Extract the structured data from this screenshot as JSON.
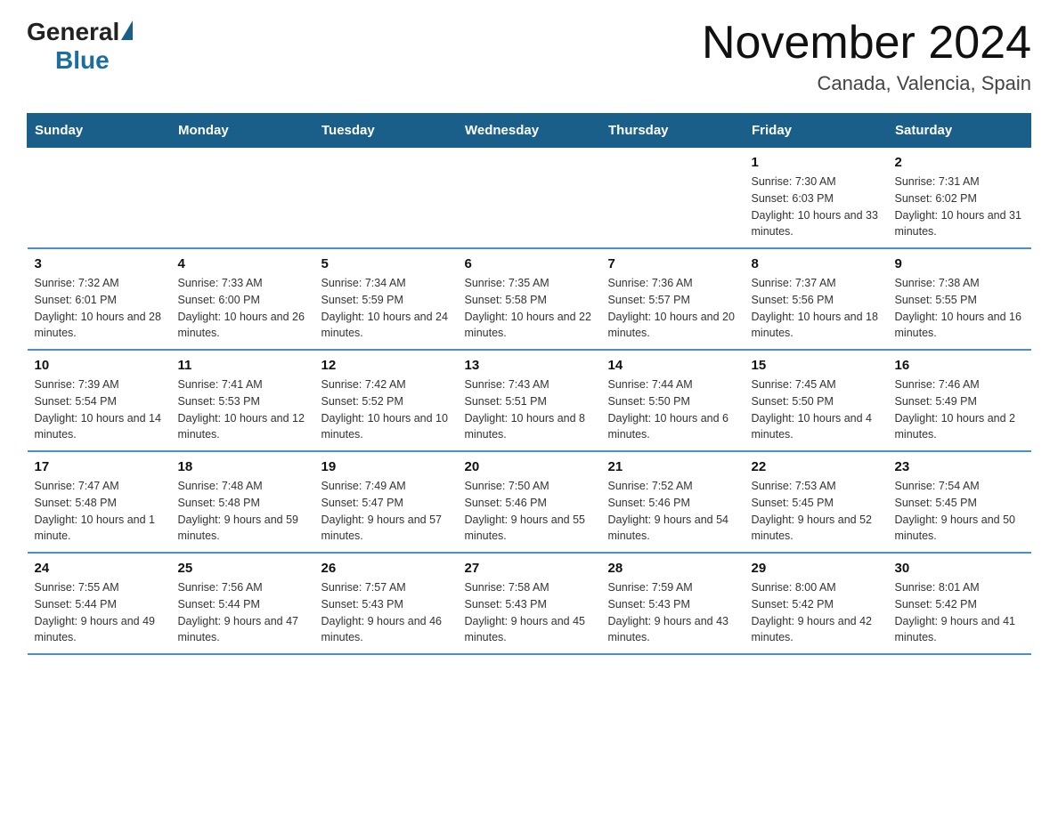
{
  "header": {
    "title": "November 2024",
    "subtitle": "Canada, Valencia, Spain",
    "logo_general": "General",
    "logo_blue": "Blue"
  },
  "days_of_week": [
    "Sunday",
    "Monday",
    "Tuesday",
    "Wednesday",
    "Thursday",
    "Friday",
    "Saturday"
  ],
  "weeks": [
    [
      {
        "day": "",
        "sunrise": "",
        "sunset": "",
        "daylight": ""
      },
      {
        "day": "",
        "sunrise": "",
        "sunset": "",
        "daylight": ""
      },
      {
        "day": "",
        "sunrise": "",
        "sunset": "",
        "daylight": ""
      },
      {
        "day": "",
        "sunrise": "",
        "sunset": "",
        "daylight": ""
      },
      {
        "day": "",
        "sunrise": "",
        "sunset": "",
        "daylight": ""
      },
      {
        "day": "1",
        "sunrise": "Sunrise: 7:30 AM",
        "sunset": "Sunset: 6:03 PM",
        "daylight": "Daylight: 10 hours and 33 minutes."
      },
      {
        "day": "2",
        "sunrise": "Sunrise: 7:31 AM",
        "sunset": "Sunset: 6:02 PM",
        "daylight": "Daylight: 10 hours and 31 minutes."
      }
    ],
    [
      {
        "day": "3",
        "sunrise": "Sunrise: 7:32 AM",
        "sunset": "Sunset: 6:01 PM",
        "daylight": "Daylight: 10 hours and 28 minutes."
      },
      {
        "day": "4",
        "sunrise": "Sunrise: 7:33 AM",
        "sunset": "Sunset: 6:00 PM",
        "daylight": "Daylight: 10 hours and 26 minutes."
      },
      {
        "day": "5",
        "sunrise": "Sunrise: 7:34 AM",
        "sunset": "Sunset: 5:59 PM",
        "daylight": "Daylight: 10 hours and 24 minutes."
      },
      {
        "day": "6",
        "sunrise": "Sunrise: 7:35 AM",
        "sunset": "Sunset: 5:58 PM",
        "daylight": "Daylight: 10 hours and 22 minutes."
      },
      {
        "day": "7",
        "sunrise": "Sunrise: 7:36 AM",
        "sunset": "Sunset: 5:57 PM",
        "daylight": "Daylight: 10 hours and 20 minutes."
      },
      {
        "day": "8",
        "sunrise": "Sunrise: 7:37 AM",
        "sunset": "Sunset: 5:56 PM",
        "daylight": "Daylight: 10 hours and 18 minutes."
      },
      {
        "day": "9",
        "sunrise": "Sunrise: 7:38 AM",
        "sunset": "Sunset: 5:55 PM",
        "daylight": "Daylight: 10 hours and 16 minutes."
      }
    ],
    [
      {
        "day": "10",
        "sunrise": "Sunrise: 7:39 AM",
        "sunset": "Sunset: 5:54 PM",
        "daylight": "Daylight: 10 hours and 14 minutes."
      },
      {
        "day": "11",
        "sunrise": "Sunrise: 7:41 AM",
        "sunset": "Sunset: 5:53 PM",
        "daylight": "Daylight: 10 hours and 12 minutes."
      },
      {
        "day": "12",
        "sunrise": "Sunrise: 7:42 AM",
        "sunset": "Sunset: 5:52 PM",
        "daylight": "Daylight: 10 hours and 10 minutes."
      },
      {
        "day": "13",
        "sunrise": "Sunrise: 7:43 AM",
        "sunset": "Sunset: 5:51 PM",
        "daylight": "Daylight: 10 hours and 8 minutes."
      },
      {
        "day": "14",
        "sunrise": "Sunrise: 7:44 AM",
        "sunset": "Sunset: 5:50 PM",
        "daylight": "Daylight: 10 hours and 6 minutes."
      },
      {
        "day": "15",
        "sunrise": "Sunrise: 7:45 AM",
        "sunset": "Sunset: 5:50 PM",
        "daylight": "Daylight: 10 hours and 4 minutes."
      },
      {
        "day": "16",
        "sunrise": "Sunrise: 7:46 AM",
        "sunset": "Sunset: 5:49 PM",
        "daylight": "Daylight: 10 hours and 2 minutes."
      }
    ],
    [
      {
        "day": "17",
        "sunrise": "Sunrise: 7:47 AM",
        "sunset": "Sunset: 5:48 PM",
        "daylight": "Daylight: 10 hours and 1 minute."
      },
      {
        "day": "18",
        "sunrise": "Sunrise: 7:48 AM",
        "sunset": "Sunset: 5:48 PM",
        "daylight": "Daylight: 9 hours and 59 minutes."
      },
      {
        "day": "19",
        "sunrise": "Sunrise: 7:49 AM",
        "sunset": "Sunset: 5:47 PM",
        "daylight": "Daylight: 9 hours and 57 minutes."
      },
      {
        "day": "20",
        "sunrise": "Sunrise: 7:50 AM",
        "sunset": "Sunset: 5:46 PM",
        "daylight": "Daylight: 9 hours and 55 minutes."
      },
      {
        "day": "21",
        "sunrise": "Sunrise: 7:52 AM",
        "sunset": "Sunset: 5:46 PM",
        "daylight": "Daylight: 9 hours and 54 minutes."
      },
      {
        "day": "22",
        "sunrise": "Sunrise: 7:53 AM",
        "sunset": "Sunset: 5:45 PM",
        "daylight": "Daylight: 9 hours and 52 minutes."
      },
      {
        "day": "23",
        "sunrise": "Sunrise: 7:54 AM",
        "sunset": "Sunset: 5:45 PM",
        "daylight": "Daylight: 9 hours and 50 minutes."
      }
    ],
    [
      {
        "day": "24",
        "sunrise": "Sunrise: 7:55 AM",
        "sunset": "Sunset: 5:44 PM",
        "daylight": "Daylight: 9 hours and 49 minutes."
      },
      {
        "day": "25",
        "sunrise": "Sunrise: 7:56 AM",
        "sunset": "Sunset: 5:44 PM",
        "daylight": "Daylight: 9 hours and 47 minutes."
      },
      {
        "day": "26",
        "sunrise": "Sunrise: 7:57 AM",
        "sunset": "Sunset: 5:43 PM",
        "daylight": "Daylight: 9 hours and 46 minutes."
      },
      {
        "day": "27",
        "sunrise": "Sunrise: 7:58 AM",
        "sunset": "Sunset: 5:43 PM",
        "daylight": "Daylight: 9 hours and 45 minutes."
      },
      {
        "day": "28",
        "sunrise": "Sunrise: 7:59 AM",
        "sunset": "Sunset: 5:43 PM",
        "daylight": "Daylight: 9 hours and 43 minutes."
      },
      {
        "day": "29",
        "sunrise": "Sunrise: 8:00 AM",
        "sunset": "Sunset: 5:42 PM",
        "daylight": "Daylight: 9 hours and 42 minutes."
      },
      {
        "day": "30",
        "sunrise": "Sunrise: 8:01 AM",
        "sunset": "Sunset: 5:42 PM",
        "daylight": "Daylight: 9 hours and 41 minutes."
      }
    ]
  ]
}
